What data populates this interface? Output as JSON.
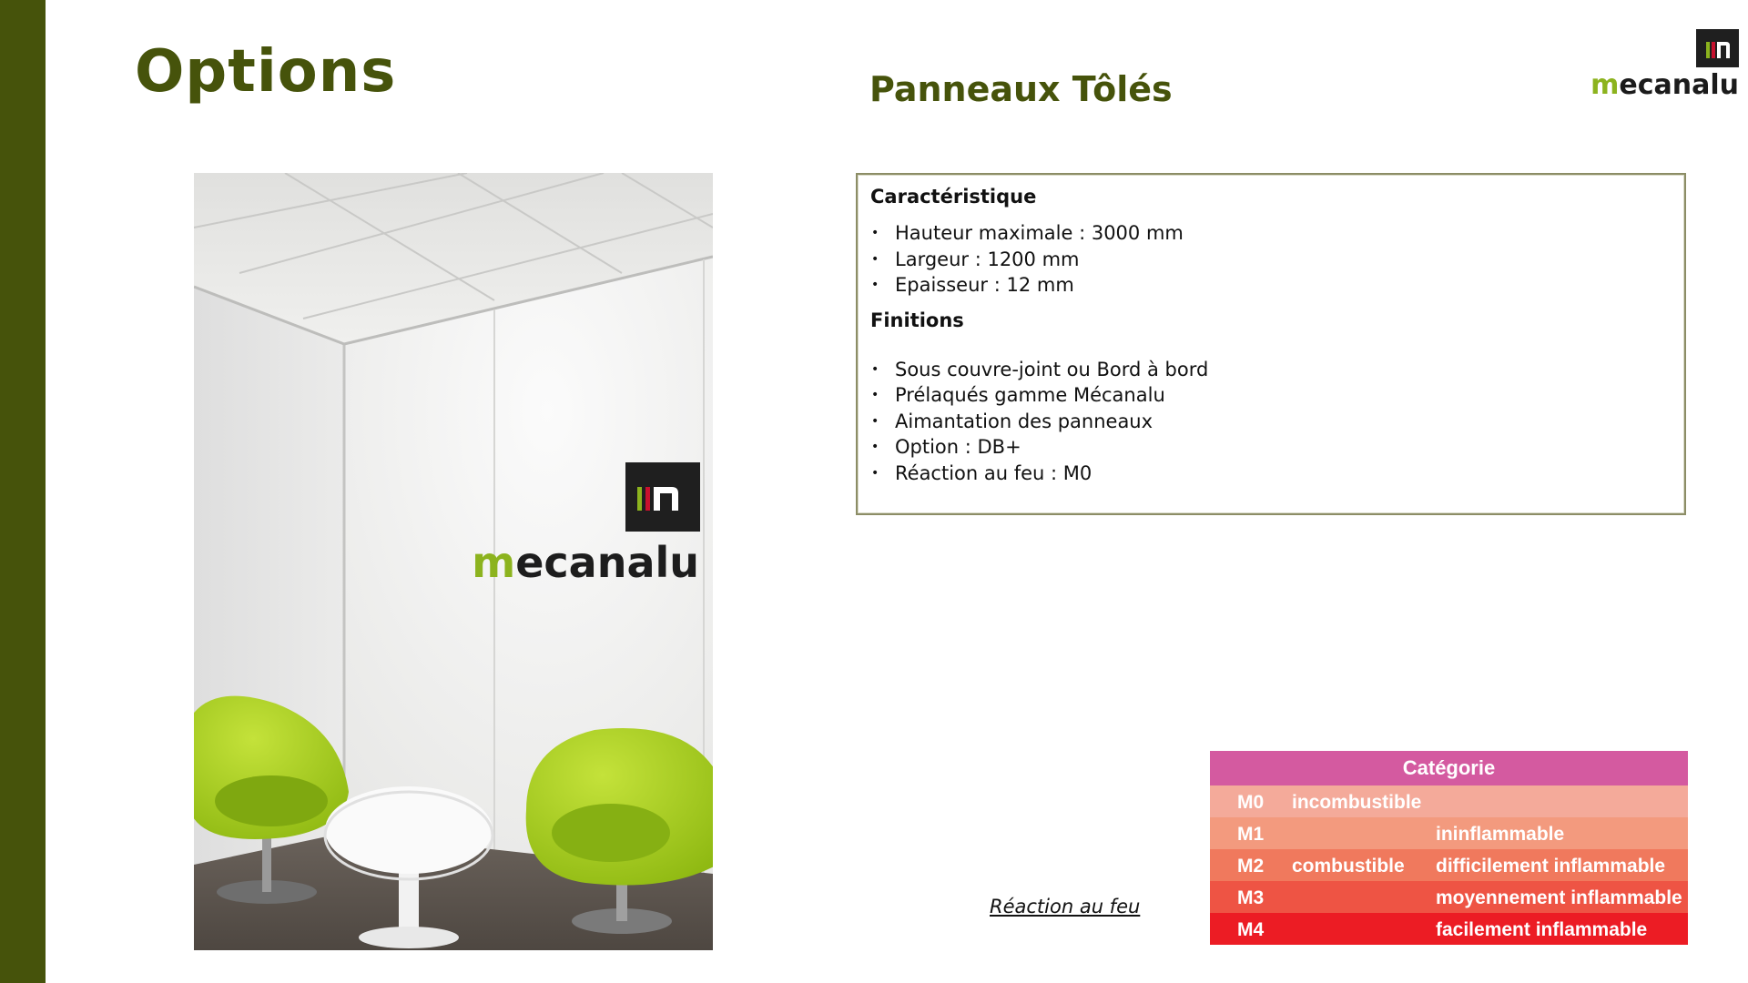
{
  "page": {
    "title": "Options",
    "subtitle": "Panneaux Tôlés"
  },
  "logo": {
    "wordmark_m": "m",
    "wordmark_rest": "ecanalu",
    "full_name": "mecanalu"
  },
  "photo": {
    "description_icon": "room-photo",
    "wall_logo_text_m": "m",
    "wall_logo_text_rest": "ecanalu"
  },
  "specs": {
    "caracteristique_heading": "Caractéristique",
    "caracteristique_items": [
      "Hauteur maximale : 3000 mm",
      "Largeur : 1200 mm",
      "Epaisseur : 12 mm"
    ],
    "finitions_heading": "Finitions",
    "finitions_items": [
      "Sous couvre-joint ou Bord à bord",
      "Prélaqués gamme Mécanalu",
      "Aimantation des panneaux",
      "Option : DB+",
      "Réaction au feu : M0"
    ]
  },
  "reaction": {
    "caption": "Réaction au feu "
  },
  "fire_table": {
    "header": "Catégorie",
    "rows": [
      {
        "code": "M0",
        "col2": "incombustible",
        "col3": ""
      },
      {
        "code": "M1",
        "col2": "",
        "col3": "ininflammable"
      },
      {
        "code": "M2",
        "col2": "combustible",
        "col3": "difficilement inflammable"
      },
      {
        "code": "M3",
        "col2": "",
        "col3": "moyennement inflammable"
      },
      {
        "code": "M4",
        "col2": "",
        "col3": "facilement inflammable"
      }
    ],
    "colors": {
      "header": "#d45aa0",
      "M0": "#f4aa9a",
      "M1": "#f39a7e",
      "M2": "#f0795d",
      "M3": "#ee5444",
      "M4": "#ec1c24"
    }
  },
  "colors": {
    "accent_olive": "#46530b",
    "chair_green": "#a6cf1e",
    "logo_green": "#8cb31e"
  }
}
